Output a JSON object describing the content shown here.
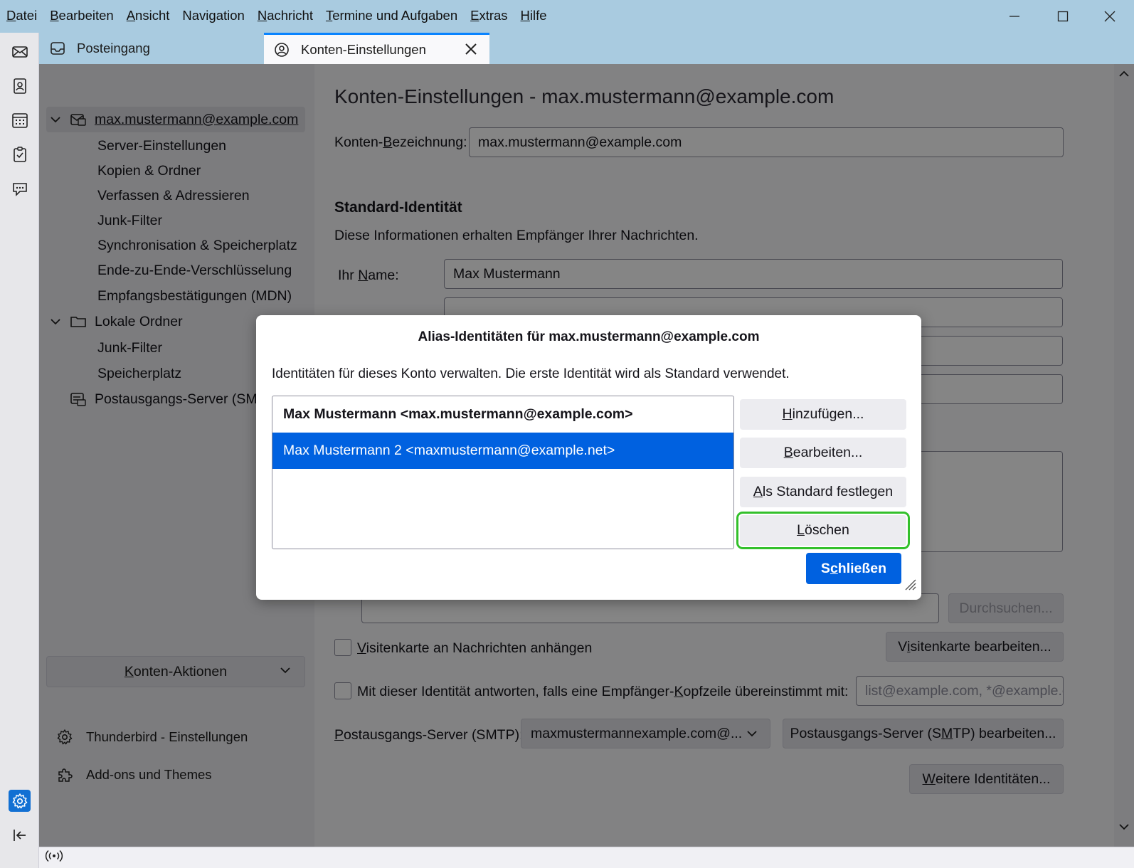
{
  "menubar": {
    "items": [
      {
        "pre": "",
        "key": "D",
        "post": "atei"
      },
      {
        "pre": "",
        "key": "B",
        "post": "earbeiten"
      },
      {
        "pre": "",
        "key": "A",
        "post": "nsicht"
      },
      {
        "pre": "Navi",
        "key": "g",
        "post": "ation"
      },
      {
        "pre": "",
        "key": "N",
        "post": "achricht"
      },
      {
        "pre": "",
        "key": "T",
        "post": "ermine und Aufgaben"
      },
      {
        "pre": "",
        "key": "E",
        "post": "xtras"
      },
      {
        "pre": "",
        "key": "H",
        "post": "ilfe"
      }
    ]
  },
  "tabs": {
    "inbox": "Posteingang",
    "settings": "Konten-Einstellungen"
  },
  "sidebar": {
    "account": "max.mustermann@example.com",
    "account_children": [
      "Server-Einstellungen",
      "Kopien & Ordner",
      "Verfassen & Adressieren",
      "Junk-Filter",
      "Synchronisation & Speicherplatz",
      "Ende-zu-Ende-Verschlüsselung",
      "Empfangsbestätigungen (MDN)"
    ],
    "local_folders": "Lokale Ordner",
    "local_children": [
      "Junk-Filter",
      "Speicherplatz"
    ],
    "smtp": "Postausgangs-Server (SMTP)",
    "account_actions": {
      "key": "K",
      "post": "onten-Aktionen"
    },
    "tb_settings": "Thunderbird - Einstellungen",
    "addons": "Add-ons und Themes"
  },
  "main": {
    "title": "Konten-Einstellungen - max.mustermann@example.com",
    "account_name_label": {
      "pre": "Konten-",
      "key": "B",
      "post": "ezeichnung:"
    },
    "account_name_value": "max.mustermann@example.com",
    "section_title": "Standard-Identität",
    "section_desc": "Diese Informationen erhalten Empfänger Ihrer Nachrichten.",
    "your_name_label": {
      "pre": "Ihr ",
      "key": "N",
      "post": "ame:"
    },
    "your_name_value": "Max Mustermann",
    "browse_button": "Durchsuchen...",
    "vcard_checkbox": {
      "pre": "",
      "key": "V",
      "post": "isitenkarte an Nachrichten anhängen"
    },
    "vcard_edit": {
      "pre": "V",
      "key": "i",
      "post": "sitenkarte bearbeiten..."
    },
    "reply_checkbox": {
      "pre": "Mit dieser Identität antworten, falls eine Empfänger-",
      "key": "K",
      "post": "opfzeile übereinstimmt mit:"
    },
    "reply_placeholder": "list@example.com, *@example.com",
    "smtp_label": {
      "pre": "",
      "key": "P",
      "post": "ostausgangs-Server (SMTP):"
    },
    "smtp_value": "maxmustermannexample.com@...",
    "smtp_edit": {
      "pre": "Postausgangs-Server (S",
      "key": "M",
      "post": "TP) bearbeiten..."
    },
    "more_identities": {
      "pre": "",
      "key": "W",
      "post": "eitere Identitäten..."
    }
  },
  "dialog": {
    "title": "Alias-Identitäten für max.mustermann@example.com",
    "description": "Identitäten für dieses Konto verwalten. Die erste Identität wird als Standard verwendet.",
    "identities": [
      "Max Mustermann <max.mustermann@example.com>",
      "Max Mustermann 2 <maxmustermann@example.net>"
    ],
    "add": {
      "pre": "",
      "key": "H",
      "post": "inzufügen..."
    },
    "edit": {
      "pre": "",
      "key": "B",
      "post": "earbeiten..."
    },
    "set_default": {
      "pre": "",
      "key": "A",
      "post": "ls Standard festlegen"
    },
    "delete": {
      "pre": "",
      "key": "L",
      "post": "öschen"
    },
    "close": {
      "pre": "S",
      "key": "c",
      "post": "hließen"
    }
  },
  "colors": {
    "titlebar": "#a9cbe0",
    "accent": "#0061e0",
    "highlight_outline": "#33c02b"
  }
}
